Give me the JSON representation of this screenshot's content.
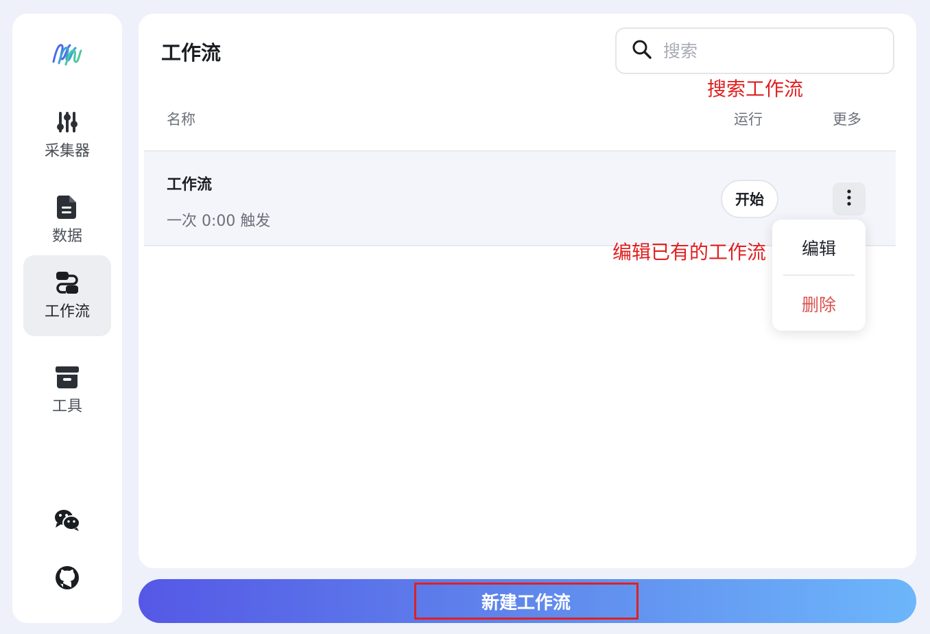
{
  "sidebar": {
    "items": [
      {
        "label": "采集器",
        "icon": "sliders-icon"
      },
      {
        "label": "数据",
        "icon": "document-icon"
      },
      {
        "label": "工作流",
        "icon": "workflow-icon",
        "active": true
      },
      {
        "label": "工具",
        "icon": "archive-box-icon"
      }
    ],
    "social": [
      {
        "icon": "wechat-icon"
      },
      {
        "icon": "github-icon"
      }
    ]
  },
  "header": {
    "title": "工作流",
    "search_placeholder": "搜索"
  },
  "annotations": {
    "search": "搜索工作流",
    "edit": "编辑已有的工作流"
  },
  "table": {
    "columns": [
      "名称",
      "运行",
      "更多"
    ],
    "rows": [
      {
        "name": "工作流",
        "trigger": "一次 0:00 触发",
        "run_label": "开始"
      }
    ]
  },
  "menu": {
    "items": [
      {
        "label": "编辑",
        "color": "#1f2329"
      },
      {
        "label": "删除",
        "color": "#d9534f"
      }
    ]
  },
  "footer": {
    "new_label": "新建工作流"
  },
  "colors": {
    "accent_from": "#5558e6",
    "accent_to": "#6db6fb",
    "annotation": "#e02020",
    "danger": "#d9534f"
  }
}
